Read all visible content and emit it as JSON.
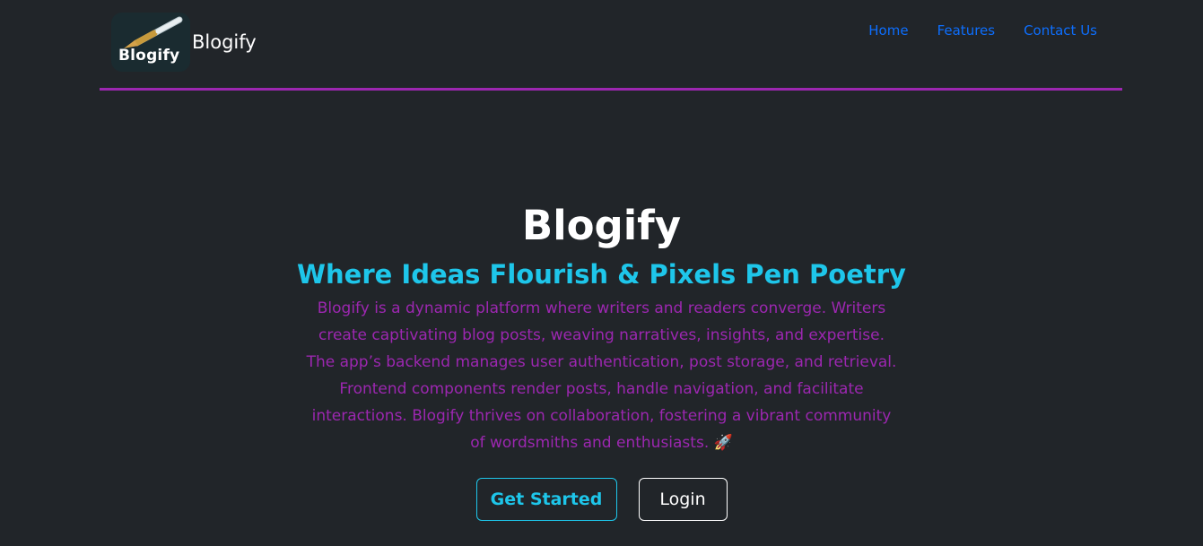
{
  "header": {
    "logo_text": "Blogify",
    "brand_name": "Blogify",
    "nav": [
      {
        "label": "Home"
      },
      {
        "label": "Features"
      },
      {
        "label": "Contact Us"
      }
    ]
  },
  "hero": {
    "title": "Blogify",
    "subtitle": "Where Ideas Flourish & Pixels Pen Poetry",
    "description": "Blogify is a dynamic platform where writers and readers converge. Writers create captivating blog posts, weaving narratives, insights, and expertise. The app’s backend manages user authentication, post storage, and retrieval. Frontend components render posts, handle navigation, and facilitate interactions. Blogify thrives on collaboration, fostering a vibrant community of wordsmiths and enthusiasts. 🚀",
    "buttons": {
      "get_started": "Get Started",
      "login": "Login"
    }
  },
  "colors": {
    "background": "#212529",
    "accent_purple": "#9c27b0",
    "accent_cyan": "#1ec6ea",
    "link_blue": "#0d6efd"
  },
  "icons": [
    "fountain-pen-icon",
    "rocket-icon"
  ]
}
